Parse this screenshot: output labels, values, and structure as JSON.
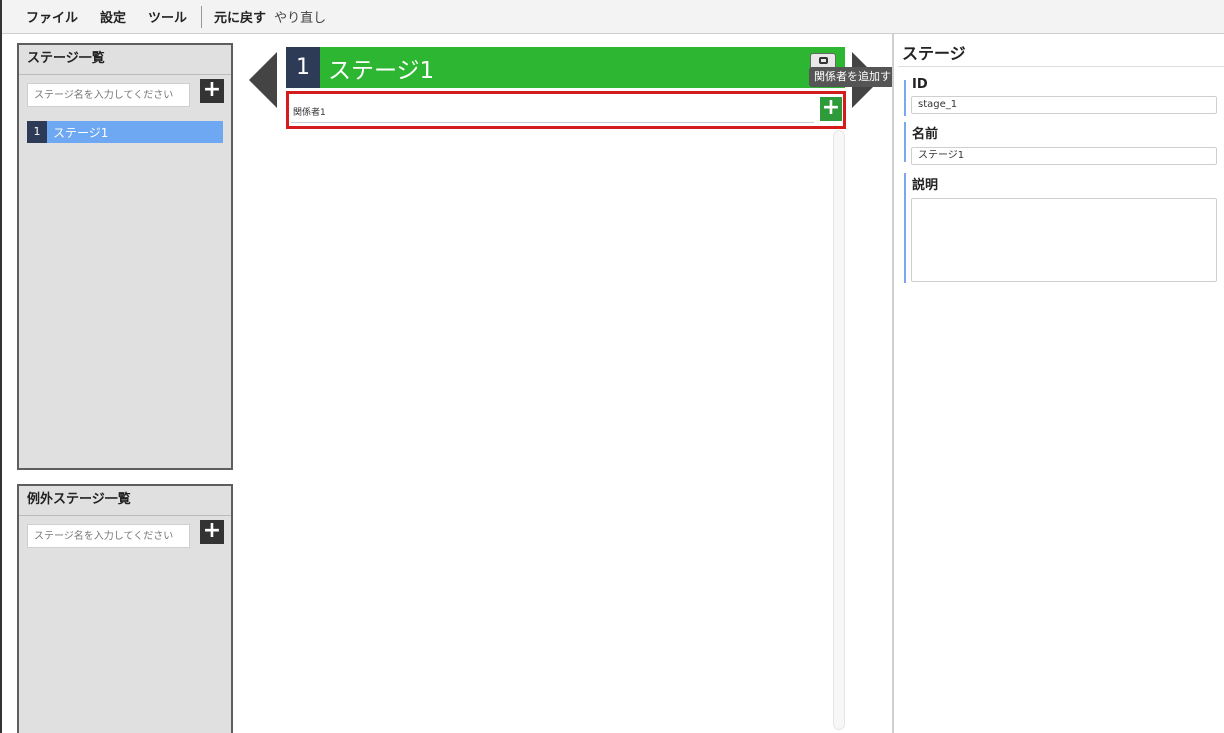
{
  "menu": {
    "file": "ファイル",
    "settings": "設定",
    "tools": "ツール",
    "undo": "元に戻す",
    "redo": "やり直し"
  },
  "stage_list": {
    "title": "ステージ一覧",
    "placeholder": "ステージ名を入力してください",
    "add_label": "+",
    "items": [
      {
        "number": "1",
        "label": "ステージ1",
        "selected": true
      }
    ]
  },
  "exception_list": {
    "title": "例外ステージ一覧",
    "placeholder": "ステージ名を入力してください",
    "add_label": "+"
  },
  "center": {
    "stage_number": "1",
    "stage_title": "ステージ1",
    "tooltip": "関係者を追加する",
    "actor_label": "関係者1",
    "add_actor_label": "+",
    "header_color": "#2db631"
  },
  "details": {
    "title": "ステージ",
    "id_label": "ID",
    "id_value": "stage_1",
    "name_label": "名前",
    "name_value": "ステージ1",
    "description_label": "説明",
    "description_value": ""
  },
  "colors": {
    "selected_item": "#6ea8f2",
    "number_badge": "#2d3b57",
    "highlight_border": "#d41c1c",
    "field_accent": "#7aa7ef"
  }
}
